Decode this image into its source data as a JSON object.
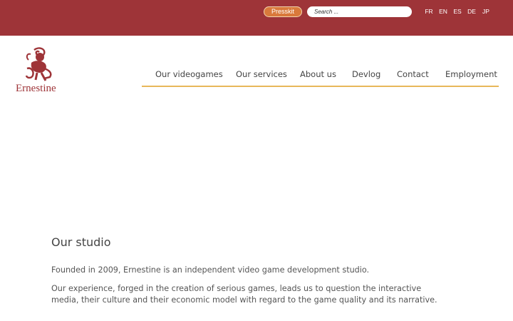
{
  "header": {
    "presskit_label": "Presskit",
    "search_placeholder": "Search ...",
    "languages": [
      "FR",
      "EN",
      "ES",
      "DE",
      "JP"
    ]
  },
  "brand": {
    "name": "Ernestine",
    "color": "#9e3438"
  },
  "colors": {
    "topbar": "#9e3438",
    "presskit": "#d9793b",
    "nav_underline": "#e8b85a"
  },
  "nav": {
    "items": [
      "Our videogames",
      "Our services",
      "About us",
      "Devlog",
      "Contact",
      "Employment"
    ]
  },
  "main": {
    "heading": "Our studio",
    "paragraphs": [
      "Founded in 2009, Ernestine is an independent video game development studio.",
      "Our experience, forged in the creation of serious games, leads us to question the interactive media, their culture and their economic model with regard to the game quality and its narrative."
    ]
  }
}
